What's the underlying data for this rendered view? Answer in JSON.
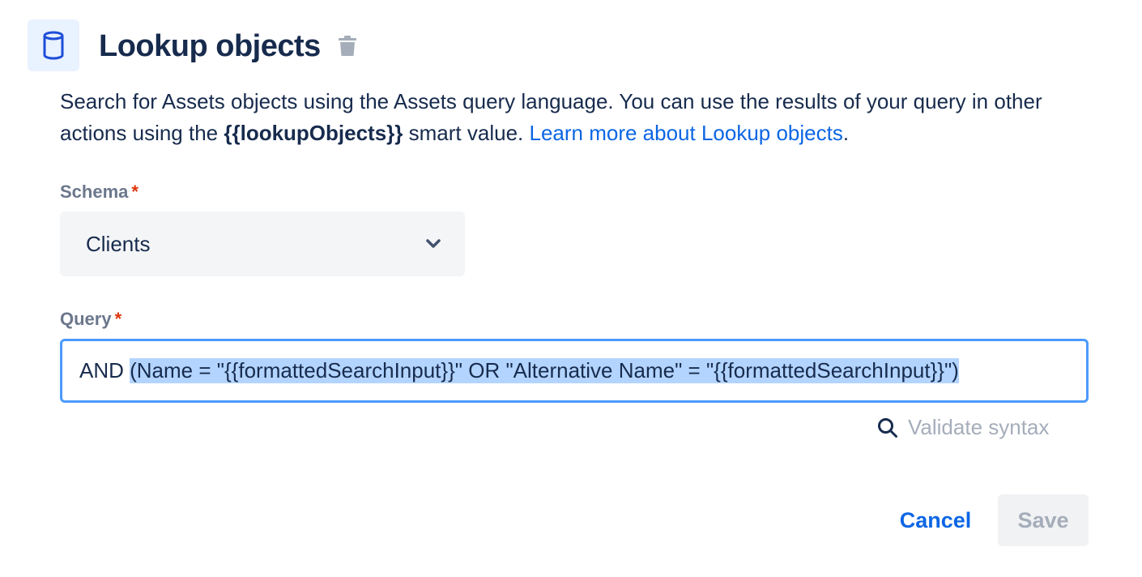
{
  "header": {
    "title": "Lookup objects",
    "icon": "database-icon",
    "delete_icon": "trash-icon"
  },
  "description": {
    "text_before": "Search for Assets objects using the Assets query language. You can use the results of your query in other actions using the ",
    "smart_value": "{{lookupObjects}}",
    "text_middle": " smart value. ",
    "link_text": "Learn more about Lookup objects",
    "text_after": "."
  },
  "schema": {
    "label": "Schema",
    "required_mark": "*",
    "value": "Clients",
    "chevron_icon": "chevron-down-icon"
  },
  "query": {
    "label": "Query",
    "required_mark": "*",
    "value_unselected": "AND ",
    "value_selected": "(Name = \"{{formattedSearchInput}}\" OR \"Alternative Name\" = \"{{formattedSearchInput}}\")"
  },
  "validate": {
    "label": "Validate syntax",
    "icon": "search-icon"
  },
  "footer": {
    "cancel_label": "Cancel",
    "save_label": "Save"
  },
  "colors": {
    "text": "#172b4d",
    "link": "#0c66e4",
    "required": "#de350b",
    "focus_border": "#4c9aff",
    "selection": "#b3d4ff",
    "muted": "#a5adba"
  }
}
